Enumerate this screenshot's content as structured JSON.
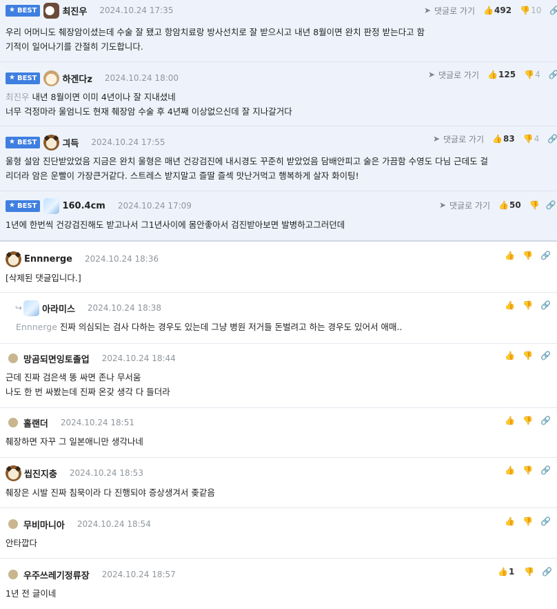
{
  "best_badge": "BEST",
  "goto_label": "댓글로 가기",
  "icons": {
    "badge": "star-icon",
    "goto": "send-icon",
    "up": "thumbs-up-icon",
    "down": "thumbs-down-icon",
    "link": "link-icon",
    "reply": "reply-arrow-icon"
  },
  "colors": {
    "best_bg": "#eef3fb",
    "badge": "#3f7fe0",
    "meta": "#8f969d",
    "mention": "#9ba3ab"
  },
  "comments": [
    {
      "name": "최진우",
      "date": "2024.10.24 17:35",
      "up": "492",
      "down": "10",
      "lines": [
        "우리 어머니도 췌장암이셨는데 수술 잘 됐고 항암치료랑 방사선치로 잘 받으시고 내년 8월이면 완치 판정 받는다고 함",
        "기적이 일어나기를 간절히 기도합니다."
      ]
    },
    {
      "name": "하겐다z",
      "date": "2024.10.24 18:00",
      "up": "125",
      "down": "4",
      "mention": "최진우",
      "lines": [
        "내년 8월이면 이미 4년이나 잘 지내셨네",
        "너무 걱정마라 울엄니도 현재 췌장암 수술 후 4년째 이상없으신데 잘 지나갈거다"
      ]
    },
    {
      "name": "긔득",
      "date": "2024.10.24 17:55",
      "up": "83",
      "down": "4",
      "lines": [
        "울형 설암 진단받았었음 지금은 완치 울형은 매년 건강검진에 내시경도 꾸준히 받았었음 담배안피고 술은 가끔함 수영도 다님 근데도 걸",
        "리더라 암은 운빨이 가장큰거같다. 스트레스 받지말고 즐딸 즐섹 맛난거먹고 행복하게 살자 화이팅!"
      ]
    },
    {
      "name": "160.4cm",
      "date": "2024.10.24 17:09",
      "up": "50",
      "lines": [
        "1년에 한번씩 건강검진해도 받고나서 그1년사이에 몸안좋아서 검진받아보면 발병하고그러던데"
      ]
    },
    {
      "name": "Ennnerge",
      "date": "2024.10.24 18:36",
      "lines": [
        "[삭제된 댓글입니다.]"
      ]
    },
    {
      "name": "아라미스",
      "date": "2024.10.24 18:38",
      "mention": "Ennnerge",
      "lines": [
        "진짜 의심되는 검사 다하는 경우도 있는데 그냥 병원 저거들 돈벌려고 하는 경우도 있어서 애매.."
      ]
    },
    {
      "name": "망곰되면잉토졸업",
      "date": "2024.10.24 18:44",
      "lines": [
        "근데 진짜 검은색 똥 싸면 존나 무서움",
        "나도 한 번 싸봤는데 진짜 온갖 생각 다 들더라"
      ]
    },
    {
      "name": "홀랜더",
      "date": "2024.10.24 18:51",
      "lines": [
        "췌장하면 자꾸 그 일본애니만 생각나네"
      ]
    },
    {
      "name": "씹진지충",
      "date": "2024.10.24 18:53",
      "lines": [
        "췌장은 시발 진짜 침묵이라 다 진행되야 증상생겨서 좆같음"
      ]
    },
    {
      "name": "무비마니아",
      "date": "2024.10.24 18:54",
      "lines": [
        "안타깝다"
      ]
    },
    {
      "name": "우주쓰레기정류장",
      "date": "2024.10.24 18:57",
      "up": "1",
      "lines": [
        "1년 전 글이네"
      ]
    }
  ]
}
